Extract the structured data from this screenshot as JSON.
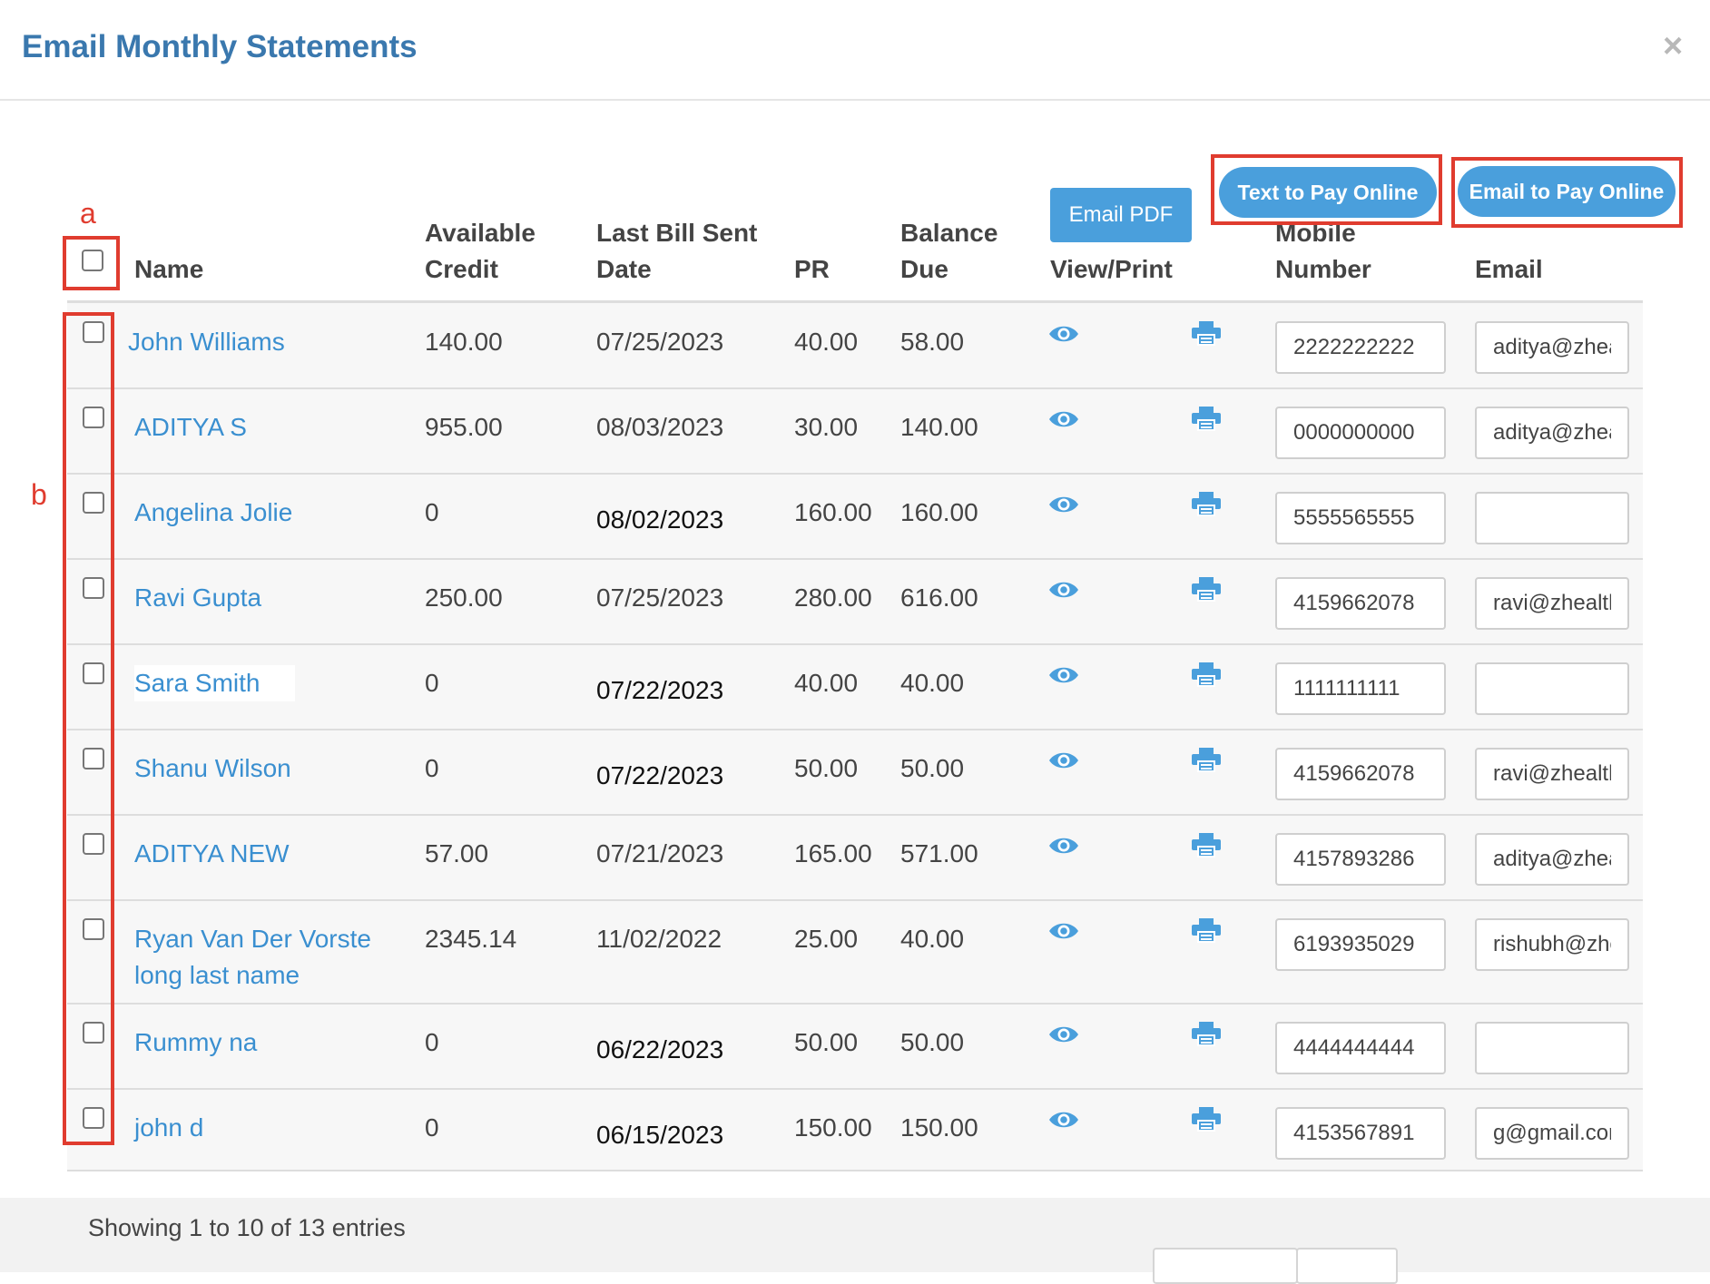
{
  "modal": {
    "title": "Email Monthly Statements",
    "close_label": "×"
  },
  "annotations": {
    "a": "a",
    "b": "b"
  },
  "actions": {
    "email_pdf": "Email PDF",
    "text_to_pay": "Text to Pay Online",
    "email_to_pay": "Email to Pay Online"
  },
  "columns": {
    "name": "Name",
    "available_credit": [
      "Available",
      "Credit"
    ],
    "last_bill": [
      "Last Bill Sent",
      "Date"
    ],
    "pr": "PR",
    "balance_due": [
      "Balance",
      "Due"
    ],
    "view_print": "View/Print",
    "mobile": [
      "Mobile",
      "Number"
    ],
    "email": "Email"
  },
  "rows": [
    {
      "name": [
        "John Williams"
      ],
      "credit": "140.00",
      "date": "07/25/2023",
      "pr": "40.00",
      "balance": "58.00",
      "mobile": "2222222222",
      "email": "aditya@zhealth"
    },
    {
      "name": [
        "ADITYA S"
      ],
      "credit": "955.00",
      "date": "08/03/2023",
      "pr": "30.00",
      "balance": "140.00",
      "mobile": "0000000000",
      "email": "aditya@zhealth"
    },
    {
      "name": [
        "Angelina Jolie"
      ],
      "credit": "0",
      "date": "08/02/2023",
      "pr": "160.00",
      "balance": "160.00",
      "mobile": "5555565555",
      "email": ""
    },
    {
      "name": [
        "Ravi Gupta"
      ],
      "credit": "250.00",
      "date": "07/25/2023",
      "pr": "280.00",
      "balance": "616.00",
      "mobile": "4159662078",
      "email": "ravi@zhealth"
    },
    {
      "name": [
        "Sara Smith"
      ],
      "credit": "0",
      "date": "07/22/2023",
      "pr": "40.00",
      "balance": "40.00",
      "mobile": "1111111111",
      "email": ""
    },
    {
      "name": [
        "Shanu Wilson"
      ],
      "credit": "0",
      "date": "07/22/2023",
      "pr": "50.00",
      "balance": "50.00",
      "mobile": "4159662078",
      "email": "ravi@zhealth"
    },
    {
      "name": [
        "ADITYA NEW"
      ],
      "credit": "57.00",
      "date": "07/21/2023",
      "pr": "165.00",
      "balance": "571.00",
      "mobile": "4157893286",
      "email": "aditya@zhealth"
    },
    {
      "name": [
        "Ryan Van Der Vorste",
        "long last name"
      ],
      "credit": "2345.14",
      "date": "11/02/2022",
      "pr": "25.00",
      "balance": "40.00",
      "mobile": "6193935029",
      "email": "rishubh@zhealth"
    },
    {
      "name": [
        "Rummy na"
      ],
      "credit": "0",
      "date": "06/22/2023",
      "pr": "50.00",
      "balance": "50.00",
      "mobile": "4444444444",
      "email": ""
    },
    {
      "name": [
        "john d"
      ],
      "credit": "0",
      "date": "06/15/2023",
      "pr": "150.00",
      "balance": "150.00",
      "mobile": "4153567891",
      "email": "g@gmail.com"
    }
  ],
  "footer": {
    "entries_text": "Showing 1 to 10 of 13 entries"
  },
  "colors": {
    "accent": "#4a9fdc",
    "title": "#3a78ae",
    "link": "#3a8fd0",
    "annotation": "#e03c2f"
  }
}
